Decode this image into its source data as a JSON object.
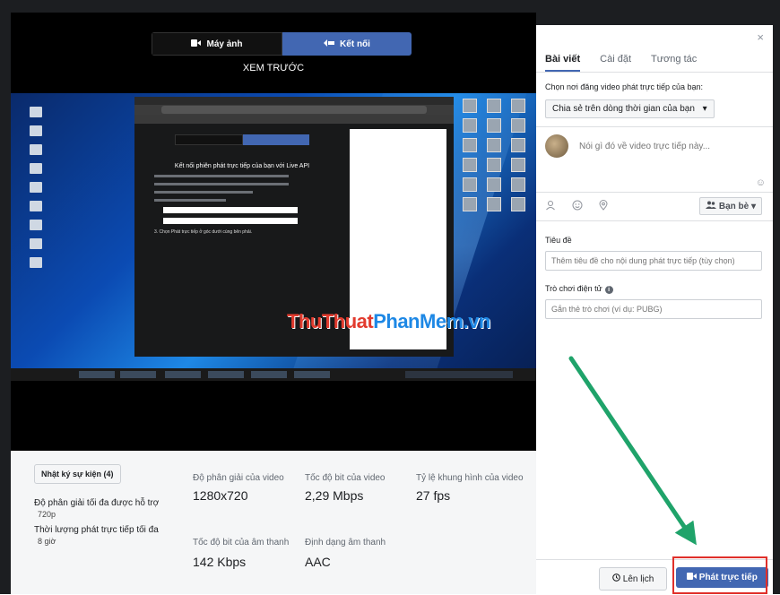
{
  "camera_switch": {
    "camera_label": "Máy ảnh",
    "connect_label": "Kết nối"
  },
  "preview": {
    "title": "XEM TRƯỚC",
    "inner": {
      "heading": "Kết nối phiên phát trực tiếp của bạn với Live API",
      "step3": "3. Chọn Phát trực tiếp ở góc dưới cùng bên phải.",
      "watermark": "ThuThuatPhanMem.vn"
    }
  },
  "stats": {
    "log_button": "Nhật ký sự kiện (4)",
    "max_res_label": "Độ phân giải tối đa được hỗ trợ",
    "max_res_value": "720p",
    "max_time_label": "Thời lượng phát trực tiếp tối đa",
    "max_time_value": "8 giờ",
    "resolution": {
      "label": "Độ phân giải của video",
      "value": "1280x720"
    },
    "video_bitrate": {
      "label": "Tốc độ bit của video",
      "value": "2,29 Mbps"
    },
    "framerate": {
      "label": "Tỷ lệ khung hình của video",
      "value": "27 fps"
    },
    "audio_bitrate": {
      "label": "Tốc độ bit của âm thanh",
      "value": "142 Kbps"
    },
    "format": {
      "label": "Định dạng âm thanh",
      "value": "AAC"
    }
  },
  "panel": {
    "close": "×",
    "tabs": [
      {
        "label": "Bài viết",
        "active": true
      },
      {
        "label": "Cài đặt",
        "active": false
      },
      {
        "label": "Tương tác",
        "active": false
      }
    ],
    "where_label": "Chọn nơi đăng video phát trực tiếp của bạn:",
    "share_target": "Chia sẻ trên dòng thời gian của bạn",
    "post_placeholder": "Nói gì đó về video trực tiếp này...",
    "audience": "Bạn bè",
    "title_label": "Tiêu đề",
    "title_placeholder": "Thêm tiêu đề cho nội dung phát trực tiếp (tùy chọn)",
    "game_label": "Trò chơi điện tử",
    "game_placeholder": "Gắn thẻ trò chơi (ví dụ: PUBG)",
    "schedule_button": "Lên lịch",
    "go_live_button": "Phát trực tiếp"
  },
  "colors": {
    "accent": "#4267b2",
    "arrow": "#1fa36a",
    "highlight": "#e0302a"
  }
}
